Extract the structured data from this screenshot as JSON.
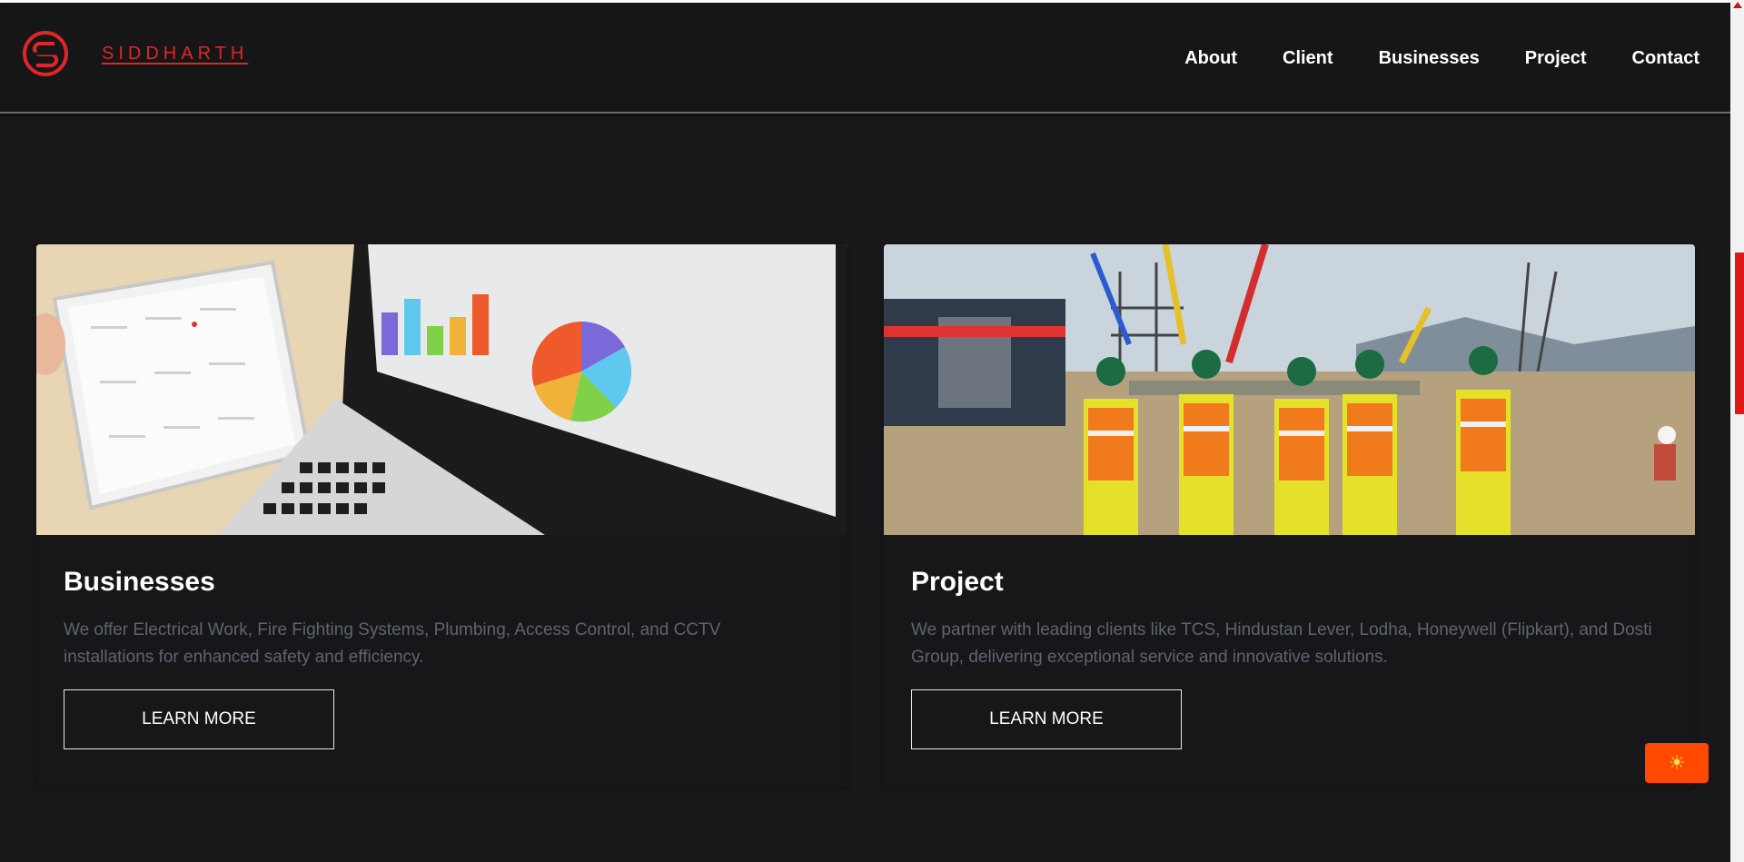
{
  "brand": {
    "name": "SIDDHARTH",
    "logo_icon": "siddharth-s-logo-icon",
    "accent": "#e0262b"
  },
  "nav": {
    "items": [
      "About",
      "Client",
      "Businesses",
      "Project",
      "Contact"
    ]
  },
  "cards": [
    {
      "image": "laptop-tablet-charts-photo",
      "title": "Businesses",
      "description": "We offer Electrical Work, Fire Fighting Systems, Plumbing, Access Control, and CCTV installations for enhanced safety and efficiency.",
      "button": "LEARN MORE"
    },
    {
      "image": "construction-workers-photo",
      "title": "Project",
      "description": "We partner with leading clients like TCS, Hindustan Lever, Lodha, Honeywell (Flipkart), and Dosti Group, delivering exceptional service and innovative solutions.",
      "button": "LEARN MORE"
    }
  ],
  "theme_toggle": {
    "icon": "sun-icon",
    "glyph": "☀",
    "color": "#ff4800"
  },
  "scrollbar": {
    "thumb_color": "#e01818"
  }
}
